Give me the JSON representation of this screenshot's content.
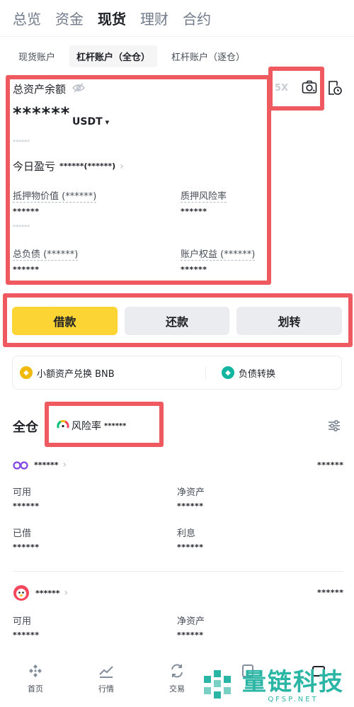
{
  "top_tabs": [
    {
      "label": "总览"
    },
    {
      "label": "资金"
    },
    {
      "label": "现货"
    },
    {
      "label": "理财"
    },
    {
      "label": "合约"
    }
  ],
  "sub_tabs": [
    {
      "label": "现货账户"
    },
    {
      "label": "杠杆账户（全仓）"
    },
    {
      "label": "杠杆账户（逐仓）"
    }
  ],
  "asset": {
    "title": "总资产余额",
    "balance": "******",
    "currency": "USDT",
    "currency_arrow": "▾",
    "sub_value": "******",
    "today_pnl_label": "今日盈亏",
    "today_pnl_value": "******(******)",
    "leverage": "5X",
    "collateral_label": "抵押物价值 (******)",
    "collateral_value": "******",
    "collateral_sub": "******",
    "margin_risk_label": "质押风险率",
    "margin_risk_value": "******",
    "total_debt_label": "总负债 (******)",
    "total_debt_value": "******",
    "account_equity_label": "账户权益 (******)",
    "account_equity_value": "******"
  },
  "actions": {
    "borrow": "借款",
    "repay": "还款",
    "transfer": "划转"
  },
  "quick": {
    "small_convert": "小额资产兑换 BNB",
    "debt_transfer": "负债转换"
  },
  "cross": {
    "title": "全仓",
    "risk_label": "风险率",
    "risk_value": "******"
  },
  "assets": [
    {
      "name": "******",
      "amount": "******",
      "available_label": "可用",
      "available": "******",
      "net_label": "净资产",
      "net": "******",
      "borrowed_label": "已借",
      "borrowed": "******",
      "interest_label": "利息",
      "interest": "******"
    },
    {
      "name": "******",
      "amount": "******",
      "available_label": "可用",
      "available": "******",
      "net_label": "净资产",
      "net": "******"
    }
  ],
  "bottom_nav": [
    {
      "label": "首页",
      "icon": "home-icon"
    },
    {
      "label": "行情",
      "icon": "markets-icon"
    },
    {
      "label": "交易",
      "icon": "trade-icon"
    },
    {
      "label": "",
      "icon": "futures-icon"
    },
    {
      "label": "",
      "icon": "wallet-icon"
    }
  ],
  "watermark": {
    "title": "量链科技",
    "subtitle": "QFSP.NET"
  },
  "colors": {
    "accent": "#fcd535",
    "highlight": "#ee5a5f",
    "text": "#1e2026",
    "muted": "#707a8a"
  }
}
